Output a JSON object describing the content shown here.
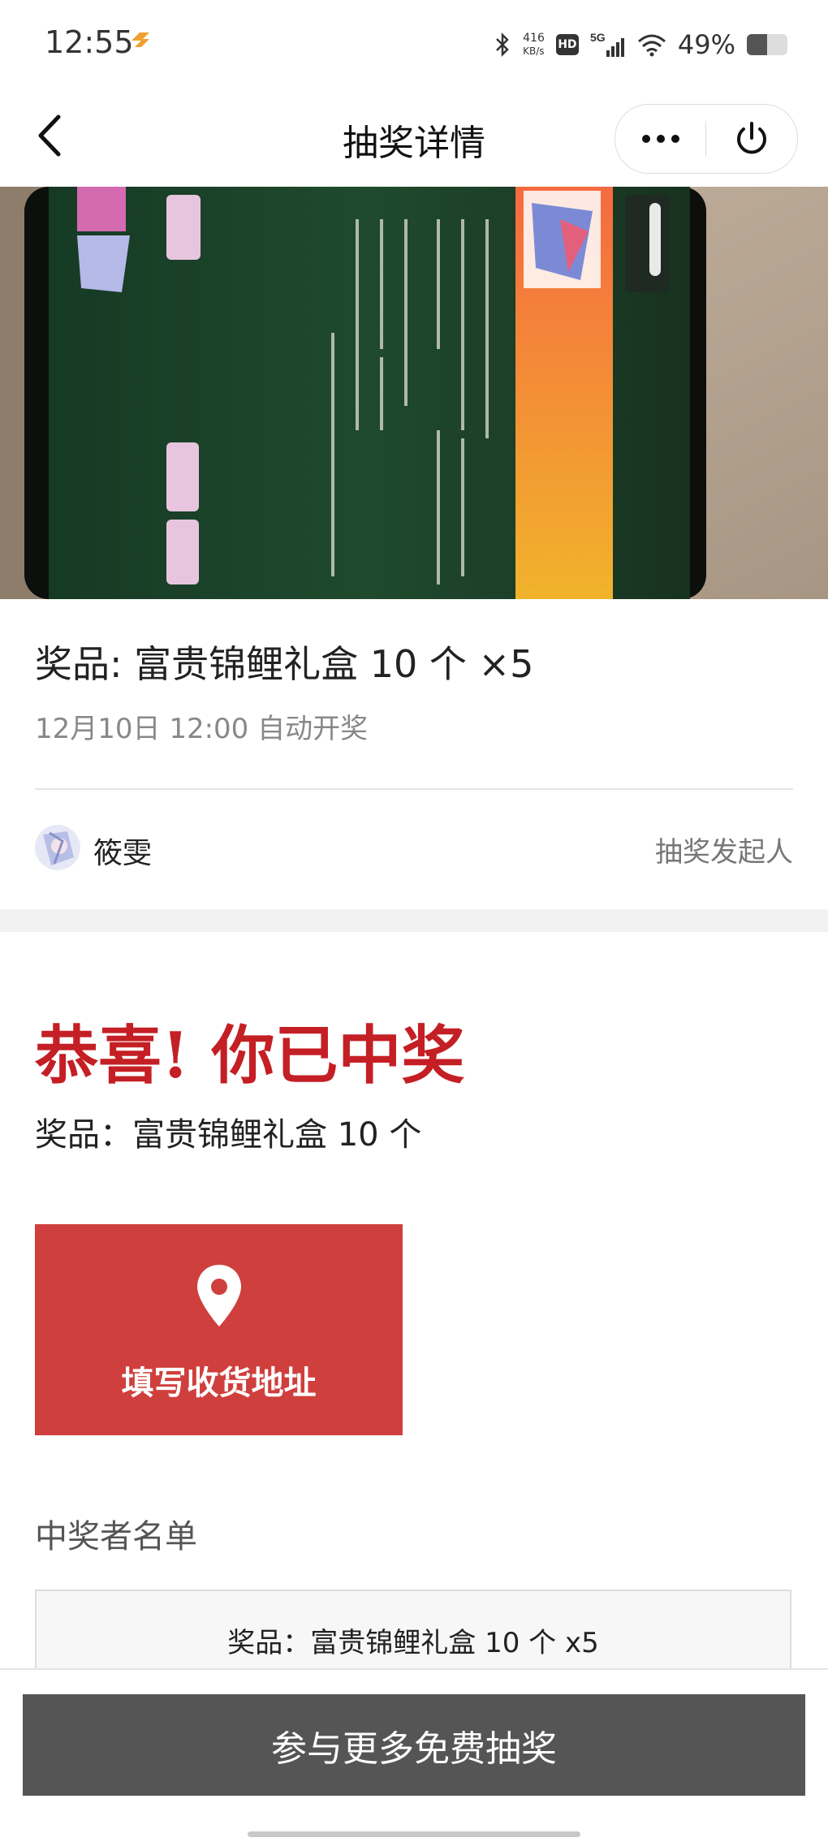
{
  "status_bar": {
    "time": "12:55",
    "network_speed_value": "416",
    "network_speed_unit": "KB/s",
    "hd_label": "HD",
    "signal_label": "5G",
    "battery_text": "49%",
    "battery_level": 0.49,
    "icons": [
      "app-brand-icon",
      "bluetooth-icon",
      "hd-icon",
      "signal-5g-icon",
      "wifi-icon",
      "battery-icon"
    ]
  },
  "nav": {
    "title": "抽奖详情",
    "icons": [
      "back-arrow-icon",
      "more-dots-icon",
      "power-icon"
    ]
  },
  "prize": {
    "title": "奖品: 富贵锦鲤礼盒 10 个 ×5",
    "draw_time": "12月10日 12:00 自动开奖"
  },
  "sponsor": {
    "name": "筱雯",
    "role": "抽奖发起人"
  },
  "result": {
    "headline": "恭喜! 你已中奖",
    "prize_line": "奖品：富贵锦鲤礼盒 10 个",
    "address_button_label": "填写收货地址",
    "address_icon": "location-pin-icon"
  },
  "winners": {
    "heading": "中奖者名单",
    "box_title": "奖品：富贵锦鲤礼盒 10 个 x5"
  },
  "footer": {
    "more_button_label": "参与更多免费抽奖"
  },
  "colors": {
    "accent_red": "#c41f24",
    "button_red": "#cf3f3d",
    "footer_button": "#555555"
  }
}
